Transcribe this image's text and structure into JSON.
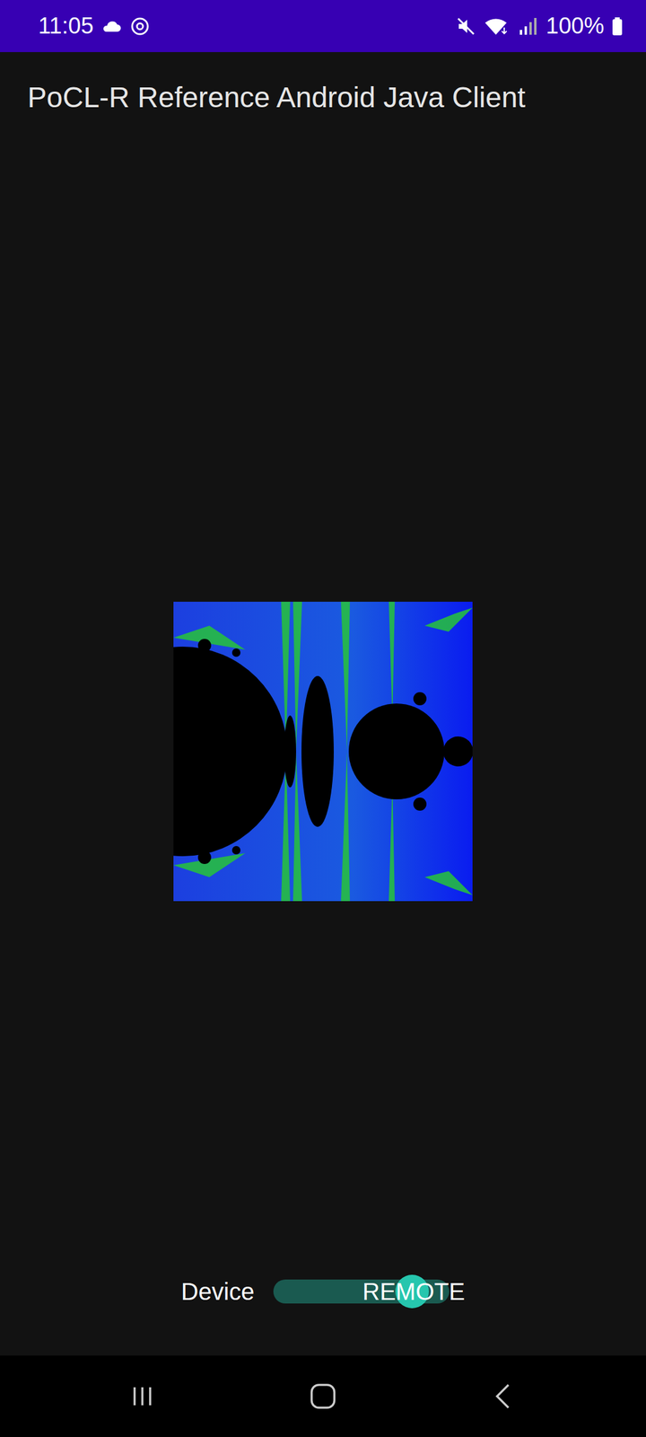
{
  "status_bar": {
    "time": "11:05",
    "battery": "100%"
  },
  "title": "PoCL-R Reference Android Java Client",
  "device_switch": {
    "label": "Device",
    "value": "REMOTE",
    "on": true
  }
}
